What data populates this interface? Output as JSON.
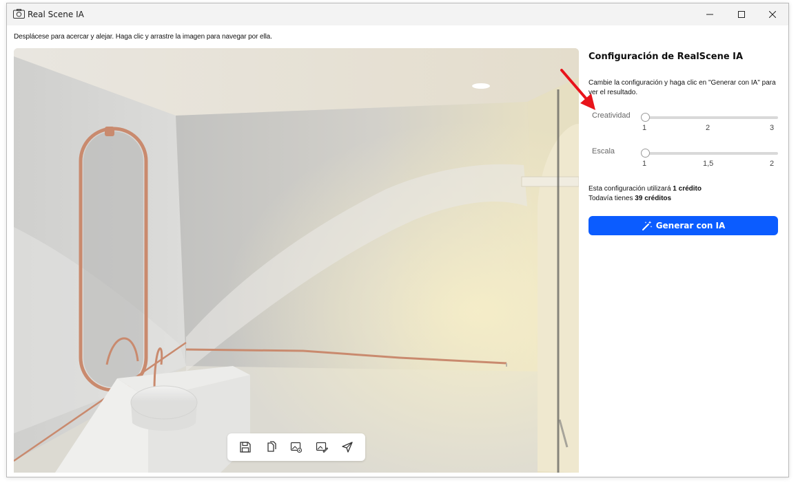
{
  "window": {
    "title": "Real Scene IA",
    "icons": {
      "app": "camera-icon",
      "minimize": "minimize-icon",
      "maximize": "maximize-icon",
      "close": "close-icon"
    }
  },
  "hint": "Desplácese para acercar y alejar. Haga clic y arrastre la imagen para navegar por ella.",
  "toolbar": {
    "buttons": [
      {
        "icon": "save-icon"
      },
      {
        "icon": "copy-icon"
      },
      {
        "icon": "image-settings-icon"
      },
      {
        "icon": "image-edit-icon"
      },
      {
        "icon": "send-icon"
      }
    ]
  },
  "panel": {
    "title": "Configuración de RealScene IA",
    "description": "Cambie la configuración y haga clic en \"Generar con IA\" para ver el resultado.",
    "sliders": [
      {
        "label": "Creatividad",
        "ticks": [
          "1",
          "2",
          "3"
        ],
        "value": 1
      },
      {
        "label": "Escala",
        "ticks": [
          "1",
          "1,5",
          "2"
        ],
        "value": 1
      }
    ],
    "credits_line1_prefix": "Esta configuración utilizará",
    "credits_line1_value": "1 crédito",
    "credits_line2_prefix": "Todavía tienes",
    "credits_line2_number": "39",
    "credits_line2_unit": "créditos",
    "generate_button": "Generar con IA",
    "generate_icon": "magic-wand-icon"
  },
  "colors": {
    "accent": "#0b5cff",
    "annotation_arrow": "#e8141b",
    "copper": "#c98a6e"
  }
}
